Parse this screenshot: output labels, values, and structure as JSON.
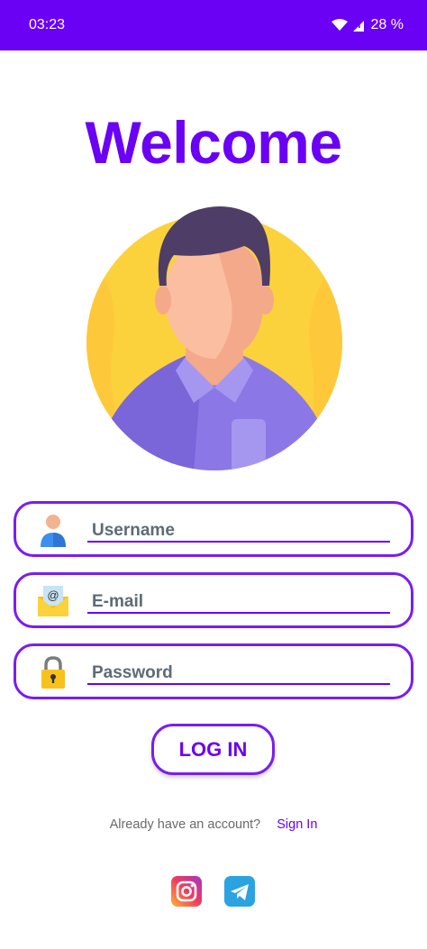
{
  "status_bar": {
    "time": "03:23",
    "battery": "28 %"
  },
  "title": "Welcome",
  "form": {
    "username_placeholder": "Username",
    "email_placeholder": "E-mail",
    "password_placeholder": "Password"
  },
  "login_label": "LOG IN",
  "footer": {
    "account_text": "Already have an account?",
    "signin_label": "Sign In"
  },
  "social": [
    "instagram-icon",
    "telegram-icon"
  ],
  "colors": {
    "accent": "#6a00f4",
    "field_border": "#7a1df1",
    "avatar_bg": "#fbd23b"
  }
}
